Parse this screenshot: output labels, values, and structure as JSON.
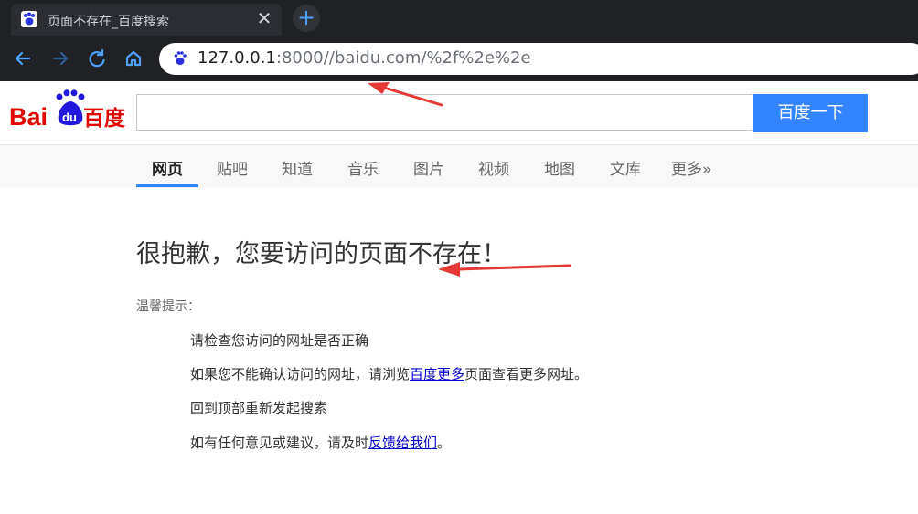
{
  "browser": {
    "tab_title": "页面不存在_百度搜索",
    "close_glyph": "✕",
    "new_tab_glyph": "+",
    "url_host": "127.0.0.1",
    "url_rest": ":8000//baidu.com/%2f%2e%2e"
  },
  "search": {
    "query": "",
    "button_label": "百度一下"
  },
  "tabs": [
    {
      "label": "网页",
      "active": true
    },
    {
      "label": "贴吧"
    },
    {
      "label": "知道"
    },
    {
      "label": "音乐"
    },
    {
      "label": "图片"
    },
    {
      "label": "视频"
    },
    {
      "label": "地图"
    },
    {
      "label": "文库"
    },
    {
      "label": "更多»"
    }
  ],
  "error": {
    "title": "很抱歉，您要访问的页面不存在！",
    "tips_label": "温馨提示：",
    "tip1": "请检查您访问的网址是否正确",
    "tip2_pre": "如果您不能确认访问的网址，请浏览",
    "tip2_link": "百度更多",
    "tip2_post": "页面查看更多网址。",
    "tip3": "回到顶部重新发起搜索",
    "tip4_pre": "如有任何意见或建议，请及时",
    "tip4_link": "反馈给我们",
    "tip4_post": "。"
  },
  "colors": {
    "accent": "#3385ff",
    "brand_red": "#e10602",
    "brand_blue": "#2319dc",
    "arrow_red": "#e53935",
    "link": "#0000cc"
  },
  "icons": [
    "baidu-paw-icon",
    "close-icon",
    "plus-icon",
    "back-arrow-icon",
    "forward-arrow-icon",
    "reload-icon",
    "home-icon",
    "baidu-logo"
  ]
}
